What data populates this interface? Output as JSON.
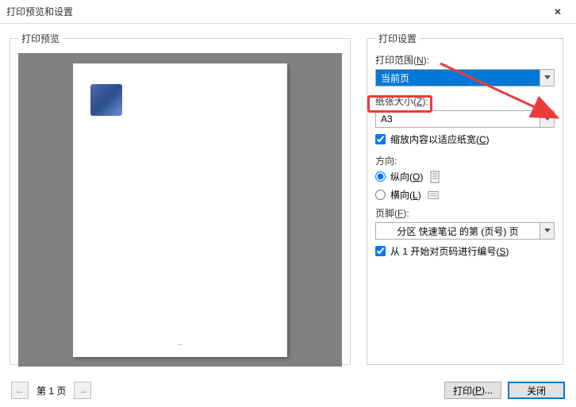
{
  "titlebar": {
    "title": "打印预览和设置",
    "close": "✕"
  },
  "preview": {
    "legend": "打印预览"
  },
  "settings": {
    "legend": "打印设置",
    "range": {
      "label": "打印范围(",
      "accel": "N",
      "label2": "):",
      "value": "当前页"
    },
    "paper": {
      "label": "纸张大小(",
      "accel": "Z",
      "label2": "):",
      "value": "A3"
    },
    "scale": {
      "label": "缩放内容以适应纸宽(",
      "accel": "C",
      "label2": ")"
    },
    "orient": {
      "label": "方向:",
      "portrait": {
        "label": "纵向(",
        "accel": "O",
        "label2": ")"
      },
      "landscape": {
        "label": "横向(",
        "accel": "L",
        "label2": ")"
      }
    },
    "footer": {
      "label": "页脚(",
      "accel": "F",
      "label2": "):",
      "value": "分区 快速笔记 的第 (页号) 页"
    },
    "numbering": {
      "label": "从 1 开始对页码进行编号(",
      "accel": "S",
      "label2": ")"
    }
  },
  "pager": {
    "prev": "←",
    "label": "第 1 页",
    "next": "→"
  },
  "buttons": {
    "print": "打印(",
    "print_accel": "P",
    "print2": ")...",
    "close": "关闭"
  }
}
